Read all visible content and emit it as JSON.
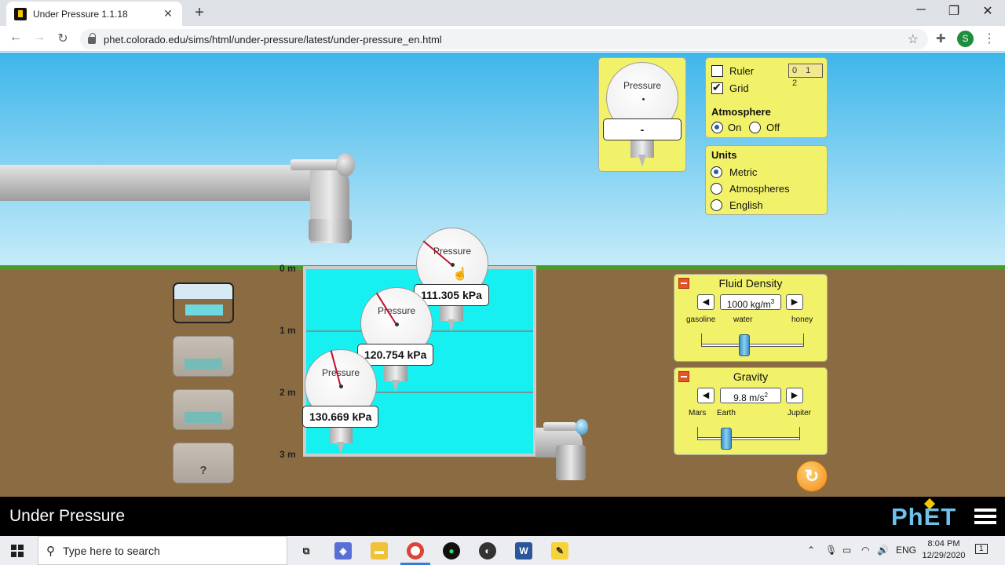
{
  "browser": {
    "tab_title": "Under Pressure 1.1.18",
    "tab_close": "✕",
    "new_tab": "+",
    "url": "phet.colorado.edu/sims/html/under-pressure/latest/under-pressure_en.html",
    "avatar_letter": "S",
    "window_controls": {
      "minimize": "─",
      "maximize": "❐",
      "close": "✕"
    }
  },
  "sim": {
    "depth_labels": [
      "0 m",
      "1 m",
      "2 m",
      "3 m"
    ],
    "scenes": [
      {
        "selected": true
      },
      {
        "selected": false
      },
      {
        "selected": false
      },
      {
        "selected": false,
        "label": "?"
      }
    ],
    "gauges": [
      {
        "label": "Pressure",
        "readout": "111.305 kPa"
      },
      {
        "label": "Pressure",
        "readout": "120.754 kPa"
      },
      {
        "label": "Pressure",
        "readout": "130.669 kPa"
      }
    ],
    "toolbox_gauge": {
      "label": "Pressure",
      "readout": "-"
    },
    "top_panel": {
      "ruler_label": "Ruler",
      "ruler_checked": false,
      "ruler_icon_text": "0 1 2",
      "grid_label": "Grid",
      "grid_checked": true,
      "atmosphere_title": "Atmosphere",
      "atmosphere_on": "On",
      "atmosphere_off": "Off",
      "atmosphere_selected": "On"
    },
    "units_panel": {
      "title": "Units",
      "options": [
        "Metric",
        "Atmospheres",
        "English"
      ],
      "selected": "Metric"
    },
    "fluid_density": {
      "title": "Fluid Density",
      "value": "1000 kg/m",
      "value_sup": "3",
      "labels": [
        "gasoline",
        "water",
        "honey"
      ],
      "fraction": 0.42
    },
    "gravity": {
      "title": "Gravity",
      "value": "9.8 m/s",
      "value_sup": "2",
      "labels": [
        "Mars",
        "Earth",
        "Jupiter"
      ],
      "fraction": 0.28
    },
    "nav_title": "Under Pressure",
    "logo": "PhET"
  },
  "taskbar": {
    "search_placeholder": "Type here to search",
    "lang": "ENG",
    "time": "8:04 PM",
    "date": "12/29/2020",
    "notification_count": "1"
  }
}
